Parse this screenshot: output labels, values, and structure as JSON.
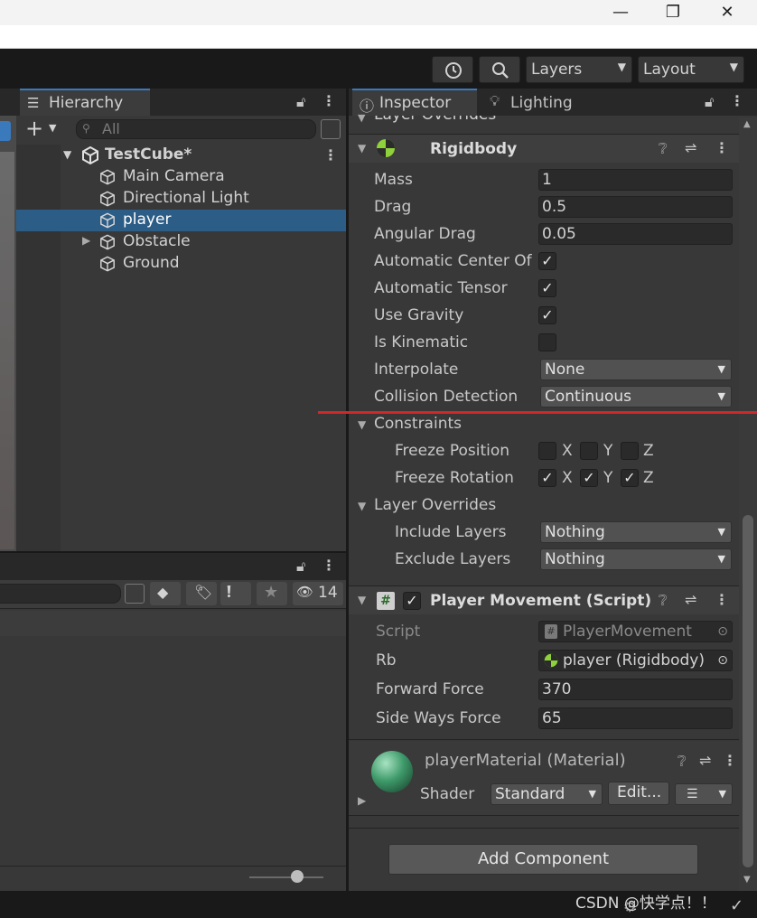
{
  "window": {
    "minimize_glyph": "—",
    "restore_glyph": "❐",
    "close_glyph": "✕"
  },
  "toolbar": {
    "history_icon": "history-icon",
    "search_icon": "search-icon",
    "layers_label": "Layers",
    "layout_label": "Layout"
  },
  "hierarchy": {
    "tab_label": "Hierarchy",
    "search_placeholder": "All",
    "scene_name": "TestCube*",
    "items": [
      {
        "label": "Main Camera",
        "selected": false,
        "expandable": false
      },
      {
        "label": "Directional Light",
        "selected": false,
        "expandable": false
      },
      {
        "label": "player",
        "selected": true,
        "expandable": false
      },
      {
        "label": "Obstacle",
        "selected": false,
        "expandable": true
      },
      {
        "label": "Ground",
        "selected": false,
        "expandable": false
      }
    ]
  },
  "project": {
    "hidden_count": "14",
    "slider_value": 0.65
  },
  "inspector": {
    "tab_label": "Inspector",
    "lighting_tab_label": "Lighting",
    "cut_header": "Layer Overrides",
    "rigidbody": {
      "title": "Rigidbody",
      "mass_label": "Mass",
      "mass": "1",
      "drag_label": "Drag",
      "drag": "0.5",
      "angular_drag_label": "Angular Drag",
      "angular_drag": "0.05",
      "auto_center_label": "Automatic Center Of",
      "auto_center": true,
      "auto_tensor_label": "Automatic Tensor",
      "auto_tensor": true,
      "use_gravity_label": "Use Gravity",
      "use_gravity": true,
      "is_kinematic_label": "Is Kinematic",
      "is_kinematic": false,
      "interpolate_label": "Interpolate",
      "interpolate": "None",
      "collision_label": "Collision Detection",
      "collision": "Continuous",
      "constraints_label": "Constraints",
      "freeze_position_label": "Freeze Position",
      "freeze_rotation_label": "Freeze Rotation",
      "x": "X",
      "y": "Y",
      "z": "Z",
      "freeze_position": [
        false,
        false,
        false
      ],
      "freeze_rotation": [
        true,
        true,
        true
      ],
      "layer_overrides_label": "Layer Overrides",
      "include_layers_label": "Include Layers",
      "include_layers": "Nothing",
      "exclude_layers_label": "Exclude Layers",
      "exclude_layers": "Nothing"
    },
    "script": {
      "title": "Player Movement (Script)",
      "script_label": "Script",
      "script_value": "PlayerMovement",
      "rb_label": "Rb",
      "rb_value": "player (Rigidbody)",
      "forward_label": "Forward Force",
      "forward_value": "370",
      "side_label": "Side Ways Force",
      "side_value": "65"
    },
    "material": {
      "title": "playerMaterial (Material)",
      "shader_label": "Shader",
      "shader_value": "Standard",
      "edit_label": "Edit..."
    },
    "add_component_label": "Add Component"
  },
  "watermark": "CSDN @快学点！！",
  "colors": {
    "selection": "#2c5d87",
    "tab_accent": "#3a79bb",
    "annotation_line": "#d0282a",
    "rigidbody_icon": "#8fd13a"
  }
}
